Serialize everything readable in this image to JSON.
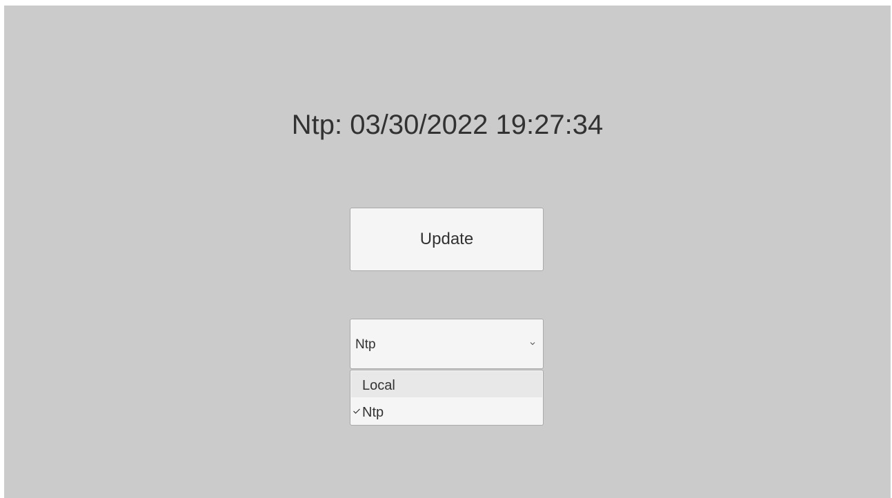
{
  "status": {
    "time_text": "Ntp: 03/30/2022 19:27:34"
  },
  "controls": {
    "update_label": "Update"
  },
  "dropdown": {
    "selected": "Ntp",
    "arrow_icon": "chevron-down-icon",
    "options": [
      {
        "label": "Local",
        "checked": false,
        "highlighted": true
      },
      {
        "label": "Ntp",
        "checked": true,
        "highlighted": false
      }
    ]
  },
  "colors": {
    "background": "#cbcbcb",
    "control": "#f5f5f5",
    "highlight": "#e8e8e8",
    "text": "#323232",
    "border": "#a9a9a9"
  }
}
